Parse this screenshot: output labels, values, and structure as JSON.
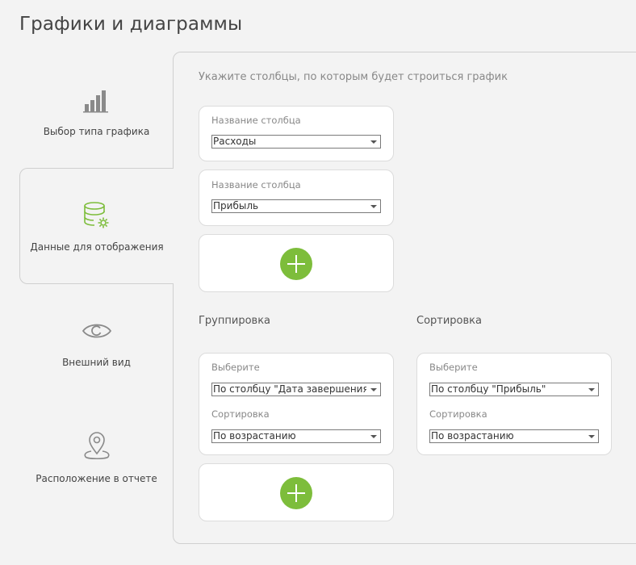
{
  "page_title": "Графики и диаграммы",
  "nav": {
    "items": [
      {
        "label": "Выбор типа графика",
        "icon": "bar-chart-icon"
      },
      {
        "label": "Данные для отображения",
        "icon": "database-gear-icon"
      },
      {
        "label": "Внешний вид",
        "icon": "eye-icon"
      },
      {
        "label": "Расположение в отчете",
        "icon": "map-pin-icon"
      }
    ]
  },
  "colors": {
    "accent": "#7dbd3b",
    "gray_icon": "#8a8a8a"
  },
  "columns": {
    "hint": "Укажите столбцы, по которым будет строиться график",
    "items": [
      {
        "label": "Название столбца",
        "value": "Расходы"
      },
      {
        "label": "Название столбца",
        "value": "Прибыль"
      }
    ]
  },
  "grouping": {
    "title": "Группировка",
    "select_label": "Выберите",
    "select_value": "По столбцу \"Дата завершения задачи\"",
    "sort_label": "Сортировка",
    "sort_value": "По возрастанию"
  },
  "sorting": {
    "title": "Сортировка",
    "select_label": "Выберите",
    "select_value": "По столбцу \"Прибыль\"",
    "sort_label": "Сортировка",
    "sort_value": "По возрастанию"
  }
}
